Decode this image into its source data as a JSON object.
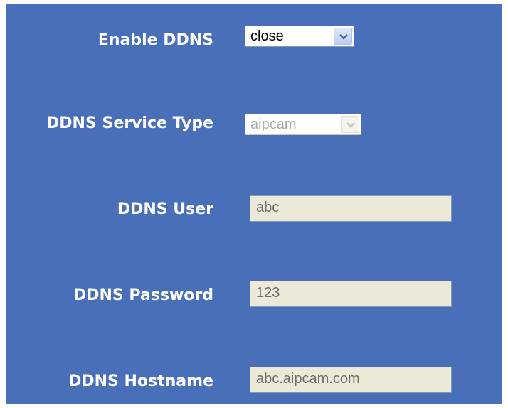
{
  "enable_ddns": {
    "label": "Enable DDNS",
    "value": "close"
  },
  "service_type": {
    "label": "DDNS Service Type",
    "value": "aipcam"
  },
  "user": {
    "label": "DDNS User",
    "value": "abc"
  },
  "password": {
    "label": "DDNS Password",
    "value": "123"
  },
  "hostname": {
    "label": "DDNS Hostname",
    "value": "abc.aipcam.com"
  },
  "colors": {
    "panel": "#4a6fb9",
    "label_text": "#ffffff",
    "field_bg": "#ece9d8"
  }
}
